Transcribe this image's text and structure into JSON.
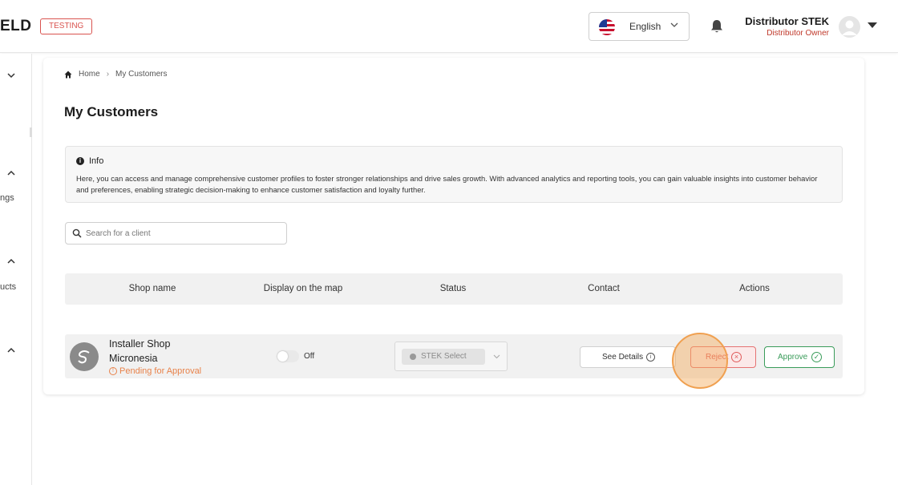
{
  "header": {
    "logo_text": "ELD",
    "env_badge": "TESTING",
    "language": "English",
    "user_name": "Distributor STEK",
    "user_role": "Distributor Owner"
  },
  "sidebar": {
    "items": [
      {
        "label": ""
      },
      {
        "label": "ngs"
      },
      {
        "label": "ucts"
      },
      {
        "label": ""
      }
    ]
  },
  "breadcrumb": {
    "home": "Home",
    "separator": "›",
    "current": "My Customers"
  },
  "page": {
    "title": "My Customers"
  },
  "info": {
    "title": "Info",
    "text": "Here, you can access and manage comprehensive customer profiles to foster stronger relationships and drive sales growth. With advanced analytics and reporting tools, you can gain valuable insights into customer behavior and preferences, enabling strategic decision-making to enhance customer satisfaction and loyalty further."
  },
  "search": {
    "placeholder": "Search for a client"
  },
  "table": {
    "columns": [
      "Shop name",
      "Display on the map",
      "Status",
      "Contact",
      "Actions"
    ],
    "rows": [
      {
        "shop_name": "Installer Shop Micronesia",
        "approval_status": "Pending for Approval",
        "display_on_map": "Off",
        "status": "STEK Select",
        "contact_button": "See Details",
        "reject_button": "Reject",
        "approve_button": "Approve"
      }
    ]
  },
  "colors": {
    "reject": "#e05a5a",
    "approve": "#3a9c5a",
    "pending": "#e8824a",
    "badge": "#d9534f"
  }
}
